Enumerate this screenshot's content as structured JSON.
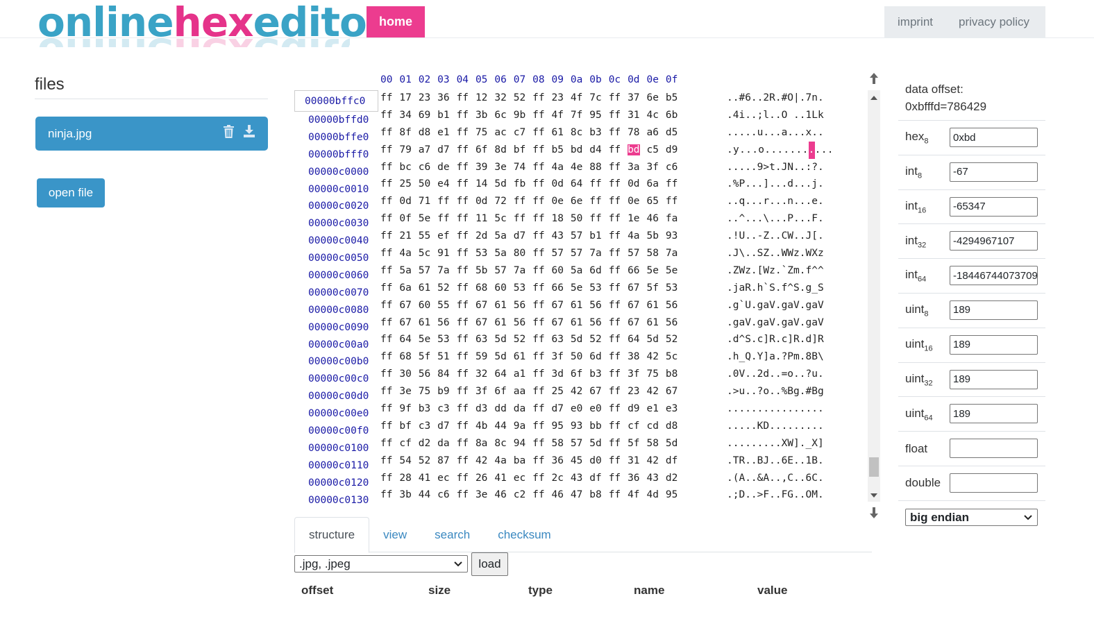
{
  "header": {
    "logo": {
      "part1": "online",
      "part2": "hex",
      "part3": "editor"
    },
    "home_label": "home",
    "nav": [
      "imprint",
      "privacy policy"
    ]
  },
  "files": {
    "title": "files",
    "items": [
      {
        "name": "ninja.jpg"
      }
    ],
    "open_label": "open file"
  },
  "hex": {
    "columns": [
      "00",
      "01",
      "02",
      "03",
      "04",
      "05",
      "06",
      "07",
      "08",
      "09",
      "0a",
      "0b",
      "0c",
      "0d",
      "0e",
      "0f"
    ],
    "offset_input": "00000bffc0",
    "selected_byte": {
      "row": 3,
      "col": 13
    },
    "rows": [
      {
        "addr": "00000bffc0",
        "bytes": [
          "ff",
          "17",
          "23",
          "36",
          "ff",
          "12",
          "32",
          "52",
          "ff",
          "23",
          "4f",
          "7c",
          "ff",
          "37",
          "6e",
          "b5"
        ],
        "ascii": "..#6..2R.#O|.7n."
      },
      {
        "addr": "00000bffd0",
        "bytes": [
          "ff",
          "34",
          "69",
          "b1",
          "ff",
          "3b",
          "6c",
          "9b",
          "ff",
          "4f",
          "7f",
          "95",
          "ff",
          "31",
          "4c",
          "6b"
        ],
        "ascii": ".4i..;l..O ..1Lk"
      },
      {
        "addr": "00000bffe0",
        "bytes": [
          "ff",
          "8f",
          "d8",
          "e1",
          "ff",
          "75",
          "ac",
          "c7",
          "ff",
          "61",
          "8c",
          "b3",
          "ff",
          "78",
          "a6",
          "d5"
        ],
        "ascii": ".....u...a...x.."
      },
      {
        "addr": "00000bfff0",
        "bytes": [
          "ff",
          "79",
          "a7",
          "d7",
          "ff",
          "6f",
          "8d",
          "bf",
          "ff",
          "b5",
          "bd",
          "d4",
          "ff",
          "bd",
          "c5",
          "d9"
        ],
        "ascii": ".y...o..........."
      },
      {
        "addr": "00000c0000",
        "bytes": [
          "ff",
          "bc",
          "c6",
          "de",
          "ff",
          "39",
          "3e",
          "74",
          "ff",
          "4a",
          "4e",
          "88",
          "ff",
          "3a",
          "3f",
          "c6"
        ],
        "ascii": ".....9>t.JN..:?."
      },
      {
        "addr": "00000c0010",
        "bytes": [
          "ff",
          "25",
          "50",
          "e4",
          "ff",
          "14",
          "5d",
          "fb",
          "ff",
          "0d",
          "64",
          "ff",
          "ff",
          "0d",
          "6a",
          "ff"
        ],
        "ascii": ".%P...]...d...j."
      },
      {
        "addr": "00000c0020",
        "bytes": [
          "ff",
          "0d",
          "71",
          "ff",
          "ff",
          "0d",
          "72",
          "ff",
          "ff",
          "0e",
          "6e",
          "ff",
          "ff",
          "0e",
          "65",
          "ff"
        ],
        "ascii": "..q...r...n...e."
      },
      {
        "addr": "00000c0030",
        "bytes": [
          "ff",
          "0f",
          "5e",
          "ff",
          "ff",
          "11",
          "5c",
          "ff",
          "ff",
          "18",
          "50",
          "ff",
          "ff",
          "1e",
          "46",
          "fa"
        ],
        "ascii": "..^...\\...P...F."
      },
      {
        "addr": "00000c0040",
        "bytes": [
          "ff",
          "21",
          "55",
          "ef",
          "ff",
          "2d",
          "5a",
          "d7",
          "ff",
          "43",
          "57",
          "b1",
          "ff",
          "4a",
          "5b",
          "93"
        ],
        "ascii": ".!U..-Z..CW..J[."
      },
      {
        "addr": "00000c0050",
        "bytes": [
          "ff",
          "4a",
          "5c",
          "91",
          "ff",
          "53",
          "5a",
          "80",
          "ff",
          "57",
          "57",
          "7a",
          "ff",
          "57",
          "58",
          "7a"
        ],
        "ascii": ".J\\..SZ..WWz.WXz"
      },
      {
        "addr": "00000c0060",
        "bytes": [
          "ff",
          "5a",
          "57",
          "7a",
          "ff",
          "5b",
          "57",
          "7a",
          "ff",
          "60",
          "5a",
          "6d",
          "ff",
          "66",
          "5e",
          "5e"
        ],
        "ascii": ".ZWz.[Wz.`Zm.f^^"
      },
      {
        "addr": "00000c0070",
        "bytes": [
          "ff",
          "6a",
          "61",
          "52",
          "ff",
          "68",
          "60",
          "53",
          "ff",
          "66",
          "5e",
          "53",
          "ff",
          "67",
          "5f",
          "53"
        ],
        "ascii": ".jaR.h`S.f^S.g_S"
      },
      {
        "addr": "00000c0080",
        "bytes": [
          "ff",
          "67",
          "60",
          "55",
          "ff",
          "67",
          "61",
          "56",
          "ff",
          "67",
          "61",
          "56",
          "ff",
          "67",
          "61",
          "56"
        ],
        "ascii": ".g`U.gaV.gaV.gaV"
      },
      {
        "addr": "00000c0090",
        "bytes": [
          "ff",
          "67",
          "61",
          "56",
          "ff",
          "67",
          "61",
          "56",
          "ff",
          "67",
          "61",
          "56",
          "ff",
          "67",
          "61",
          "56"
        ],
        "ascii": ".gaV.gaV.gaV.gaV"
      },
      {
        "addr": "00000c00a0",
        "bytes": [
          "ff",
          "64",
          "5e",
          "53",
          "ff",
          "63",
          "5d",
          "52",
          "ff",
          "63",
          "5d",
          "52",
          "ff",
          "64",
          "5d",
          "52"
        ],
        "ascii": ".d^S.c]R.c]R.d]R"
      },
      {
        "addr": "00000c00b0",
        "bytes": [
          "ff",
          "68",
          "5f",
          "51",
          "ff",
          "59",
          "5d",
          "61",
          "ff",
          "3f",
          "50",
          "6d",
          "ff",
          "38",
          "42",
          "5c"
        ],
        "ascii": ".h_Q.Y]a.?Pm.8B\\"
      },
      {
        "addr": "00000c00c0",
        "bytes": [
          "ff",
          "30",
          "56",
          "84",
          "ff",
          "32",
          "64",
          "a1",
          "ff",
          "3d",
          "6f",
          "b3",
          "ff",
          "3f",
          "75",
          "b8"
        ],
        "ascii": ".0V..2d..=o..?u."
      },
      {
        "addr": "00000c00d0",
        "bytes": [
          "ff",
          "3e",
          "75",
          "b9",
          "ff",
          "3f",
          "6f",
          "aa",
          "ff",
          "25",
          "42",
          "67",
          "ff",
          "23",
          "42",
          "67"
        ],
        "ascii": ".>u..?o..%Bg.#Bg"
      },
      {
        "addr": "00000c00e0",
        "bytes": [
          "ff",
          "9f",
          "b3",
          "c3",
          "ff",
          "d3",
          "dd",
          "da",
          "ff",
          "d7",
          "e0",
          "e0",
          "ff",
          "d9",
          "e1",
          "e3"
        ],
        "ascii": "................"
      },
      {
        "addr": "00000c00f0",
        "bytes": [
          "ff",
          "bf",
          "c3",
          "d7",
          "ff",
          "4b",
          "44",
          "9a",
          "ff",
          "95",
          "93",
          "bb",
          "ff",
          "cf",
          "cd",
          "d8"
        ],
        "ascii": ".....KD........."
      },
      {
        "addr": "00000c0100",
        "bytes": [
          "ff",
          "cf",
          "d2",
          "da",
          "ff",
          "8a",
          "8c",
          "94",
          "ff",
          "58",
          "57",
          "5d",
          "ff",
          "5f",
          "58",
          "5d"
        ],
        "ascii": ".........XW]._X]"
      },
      {
        "addr": "00000c0110",
        "bytes": [
          "ff",
          "54",
          "52",
          "87",
          "ff",
          "42",
          "4a",
          "ba",
          "ff",
          "36",
          "45",
          "d0",
          "ff",
          "31",
          "42",
          "df"
        ],
        "ascii": ".TR..BJ..6E..1B."
      },
      {
        "addr": "00000c0120",
        "bytes": [
          "ff",
          "28",
          "41",
          "ec",
          "ff",
          "26",
          "41",
          "ec",
          "ff",
          "2c",
          "43",
          "df",
          "ff",
          "36",
          "43",
          "d2"
        ],
        "ascii": ".(A..&A..,C..6C."
      },
      {
        "addr": "00000c0130",
        "bytes": [
          "ff",
          "3b",
          "44",
          "c6",
          "ff",
          "3e",
          "46",
          "c2",
          "ff",
          "46",
          "47",
          "b8",
          "ff",
          "4f",
          "4d",
          "95"
        ],
        "ascii": ".;D..>F..FG..OM."
      }
    ]
  },
  "tabs": [
    "structure",
    "view",
    "search",
    "checksum"
  ],
  "structure": {
    "format": ".jpg, .jpeg",
    "load_label": "load",
    "headers": [
      "offset",
      "size",
      "type",
      "name",
      "value"
    ]
  },
  "inspector": {
    "offset_label": "data offset:",
    "offset_value": "0xbfffd=786429",
    "rows": [
      {
        "base": "hex",
        "sub": "8",
        "value": "0xbd"
      },
      {
        "base": "int",
        "sub": "8",
        "value": "-67"
      },
      {
        "base": "int",
        "sub": "16",
        "value": "-65347"
      },
      {
        "base": "int",
        "sub": "32",
        "value": "-4294967107"
      },
      {
        "base": "int",
        "sub": "64",
        "value": "-18446744073709"
      },
      {
        "base": "uint",
        "sub": "8",
        "value": "189"
      },
      {
        "base": "uint",
        "sub": "16",
        "value": "189"
      },
      {
        "base": "uint",
        "sub": "32",
        "value": "189"
      },
      {
        "base": "uint",
        "sub": "64",
        "value": "189"
      },
      {
        "base": "float",
        "sub": "",
        "value": ""
      },
      {
        "base": "double",
        "sub": "",
        "value": ""
      }
    ],
    "endian": "big endian"
  },
  "colors": {
    "accent_pink": "#ec3c8f",
    "file_blue": "#3a95c8",
    "addr_blue": "#1a1aa6",
    "logo_blue": "#3aa3c6"
  }
}
